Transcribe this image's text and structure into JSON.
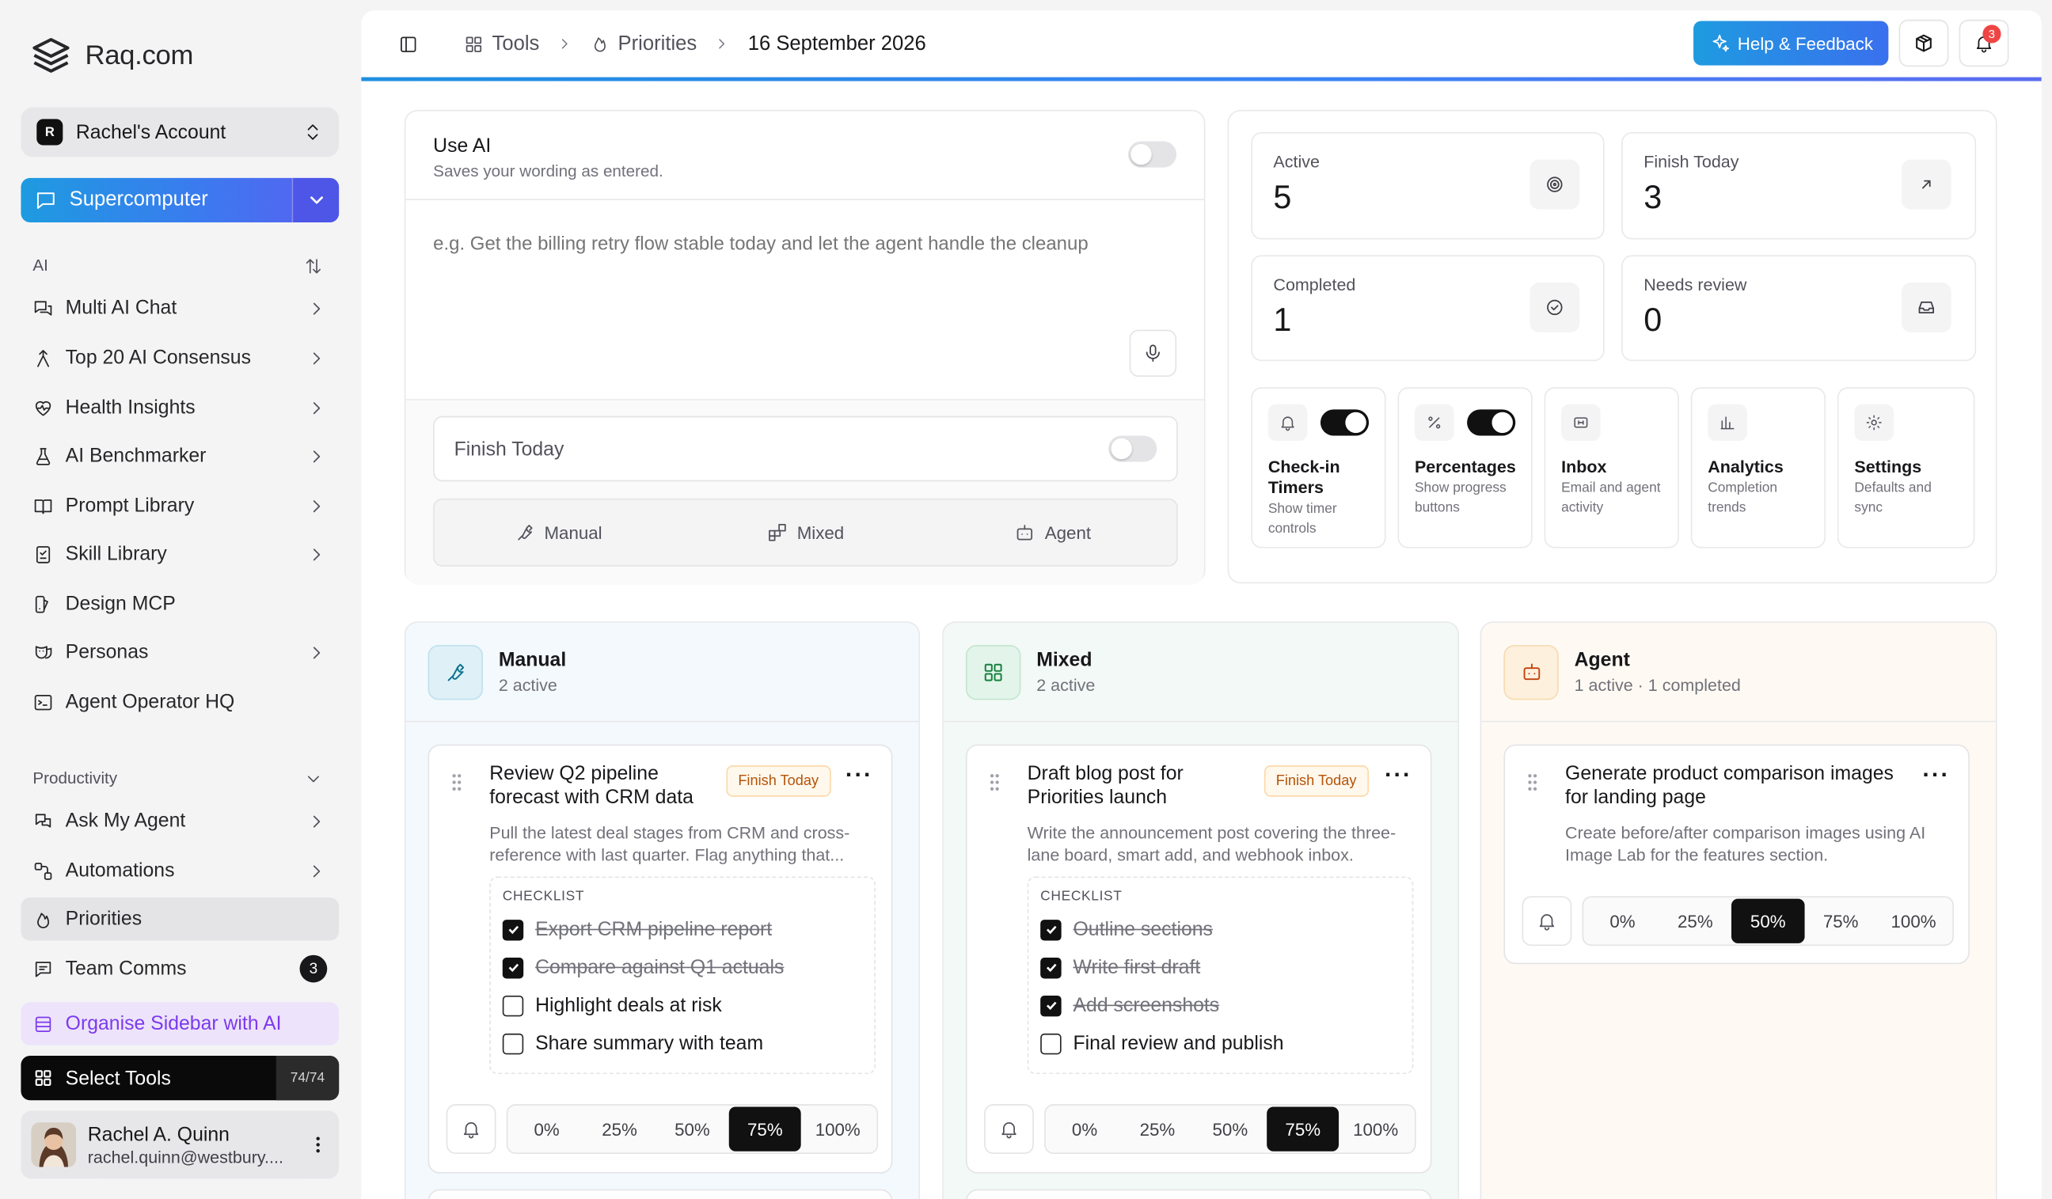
{
  "brand": {
    "name": "Raq.com"
  },
  "account": {
    "initial": "R",
    "name": "Rachel's Account"
  },
  "primary_tool": {
    "label": "Supercomputer"
  },
  "ai_section": {
    "title": "AI",
    "items": [
      {
        "label": "Multi AI Chat",
        "icon": "chat-icon"
      },
      {
        "label": "Top 20 AI Consensus",
        "icon": "branch-icon"
      },
      {
        "label": "Health Insights",
        "icon": "heart-pulse-icon"
      },
      {
        "label": "AI Benchmarker",
        "icon": "flask-icon"
      },
      {
        "label": "Prompt Library",
        "icon": "book-icon"
      },
      {
        "label": "Skill Library",
        "icon": "checklist-icon"
      },
      {
        "label": "Design MCP",
        "icon": "palette-icon"
      },
      {
        "label": "Personas",
        "icon": "mask-icon"
      },
      {
        "label": "Agent Operator HQ",
        "icon": "terminal-icon"
      }
    ]
  },
  "productivity_section": {
    "title": "Productivity",
    "items": [
      {
        "label": "Ask My Agent",
        "icon": "agent-icon"
      },
      {
        "label": "Automations",
        "icon": "automation-icon"
      },
      {
        "label": "Priorities",
        "icon": "flame-icon"
      },
      {
        "label": "Team Comms",
        "icon": "message-icon",
        "badge": "3"
      }
    ]
  },
  "organise": {
    "label": "Organise Sidebar with AI"
  },
  "select_tools": {
    "label": "Select Tools",
    "count": "74/74"
  },
  "user": {
    "name": "Rachel A. Quinn",
    "email": "rachel.quinn@westbury...."
  },
  "breadcrumb": {
    "tools": "Tools",
    "priorities": "Priorities",
    "date": "16 September 2026"
  },
  "header": {
    "help_label": "Help & Feedback",
    "notification_count": "3"
  },
  "smart_add": {
    "use_ai_title": "Use AI",
    "use_ai_sub": "Saves your wording as entered.",
    "use_ai_on": false,
    "placeholder": "e.g. Get the billing retry flow stable today and let the agent handle the cleanup",
    "finish_today_label": "Finish Today",
    "finish_today_on": false,
    "modes": [
      "Manual",
      "Mixed",
      "Agent"
    ]
  },
  "stats": [
    {
      "label": "Active",
      "value": "5",
      "icon": "target-icon"
    },
    {
      "label": "Finish Today",
      "value": "3",
      "icon": "arrow-up-right-icon"
    },
    {
      "label": "Completed",
      "value": "1",
      "icon": "check-circle-icon"
    },
    {
      "label": "Needs review",
      "value": "0",
      "icon": "inbox-icon"
    }
  ],
  "features": [
    {
      "title": "Check-in Timers",
      "desc": "Show timer controls",
      "toggle": true,
      "icon": "bell-icon"
    },
    {
      "title": "Percentages",
      "desc": "Show progress buttons",
      "toggle": true,
      "icon": "percent-icon"
    },
    {
      "title": "Inbox",
      "desc": "Email and agent activity",
      "icon": "webhook-icon"
    },
    {
      "title": "Analytics",
      "desc": "Completion trends",
      "icon": "bar-chart-icon"
    },
    {
      "title": "Settings",
      "desc": "Defaults and sync",
      "icon": "gear-icon"
    }
  ],
  "lanes": [
    {
      "title": "Manual",
      "subtitle": "2 active",
      "accent": "#0e7490",
      "bg": "#f3f9fc",
      "task": {
        "title": "Review Q2 pipeline forecast with CRM data",
        "tag": "Finish Today",
        "desc": "Pull the latest deal stages from CRM and cross-reference with last quarter. Flag anything that...",
        "checklist_title": "CHECKLIST",
        "checklist": [
          {
            "text": "Export CRM pipeline report",
            "done": true
          },
          {
            "text": "Compare against Q1 actuals",
            "done": true
          },
          {
            "text": "Highlight deals at risk",
            "done": false
          },
          {
            "text": "Share summary with team",
            "done": false
          }
        ],
        "progress": [
          "0%",
          "25%",
          "50%",
          "75%",
          "100%"
        ],
        "progress_selected": "75%"
      }
    },
    {
      "title": "Mixed",
      "subtitle": "2 active",
      "accent": "#15803d",
      "bg": "#f3f9f6",
      "task": {
        "title": "Draft blog post for Priorities launch",
        "tag": "Finish Today",
        "desc": "Write the announcement post covering the three-lane board, smart add, and webhook inbox.",
        "checklist_title": "CHECKLIST",
        "checklist": [
          {
            "text": "Outline sections",
            "done": true
          },
          {
            "text": "Write first draft",
            "done": true
          },
          {
            "text": "Add screenshots",
            "done": true
          },
          {
            "text": "Final review and publish",
            "done": false
          }
        ],
        "progress": [
          "0%",
          "25%",
          "50%",
          "75%",
          "100%"
        ],
        "progress_selected": "75%"
      }
    },
    {
      "title": "Agent",
      "subtitle": "1 active · 1 completed",
      "accent": "#c2410c",
      "bg": "#fefaf3",
      "task": {
        "title": "Generate product comparison images for landing page",
        "desc": "Create before/after comparison images using AI Image Lab for the features section.",
        "progress": [
          "0%",
          "25%",
          "50%",
          "75%",
          "100%"
        ],
        "progress_selected": "50%"
      }
    }
  ]
}
